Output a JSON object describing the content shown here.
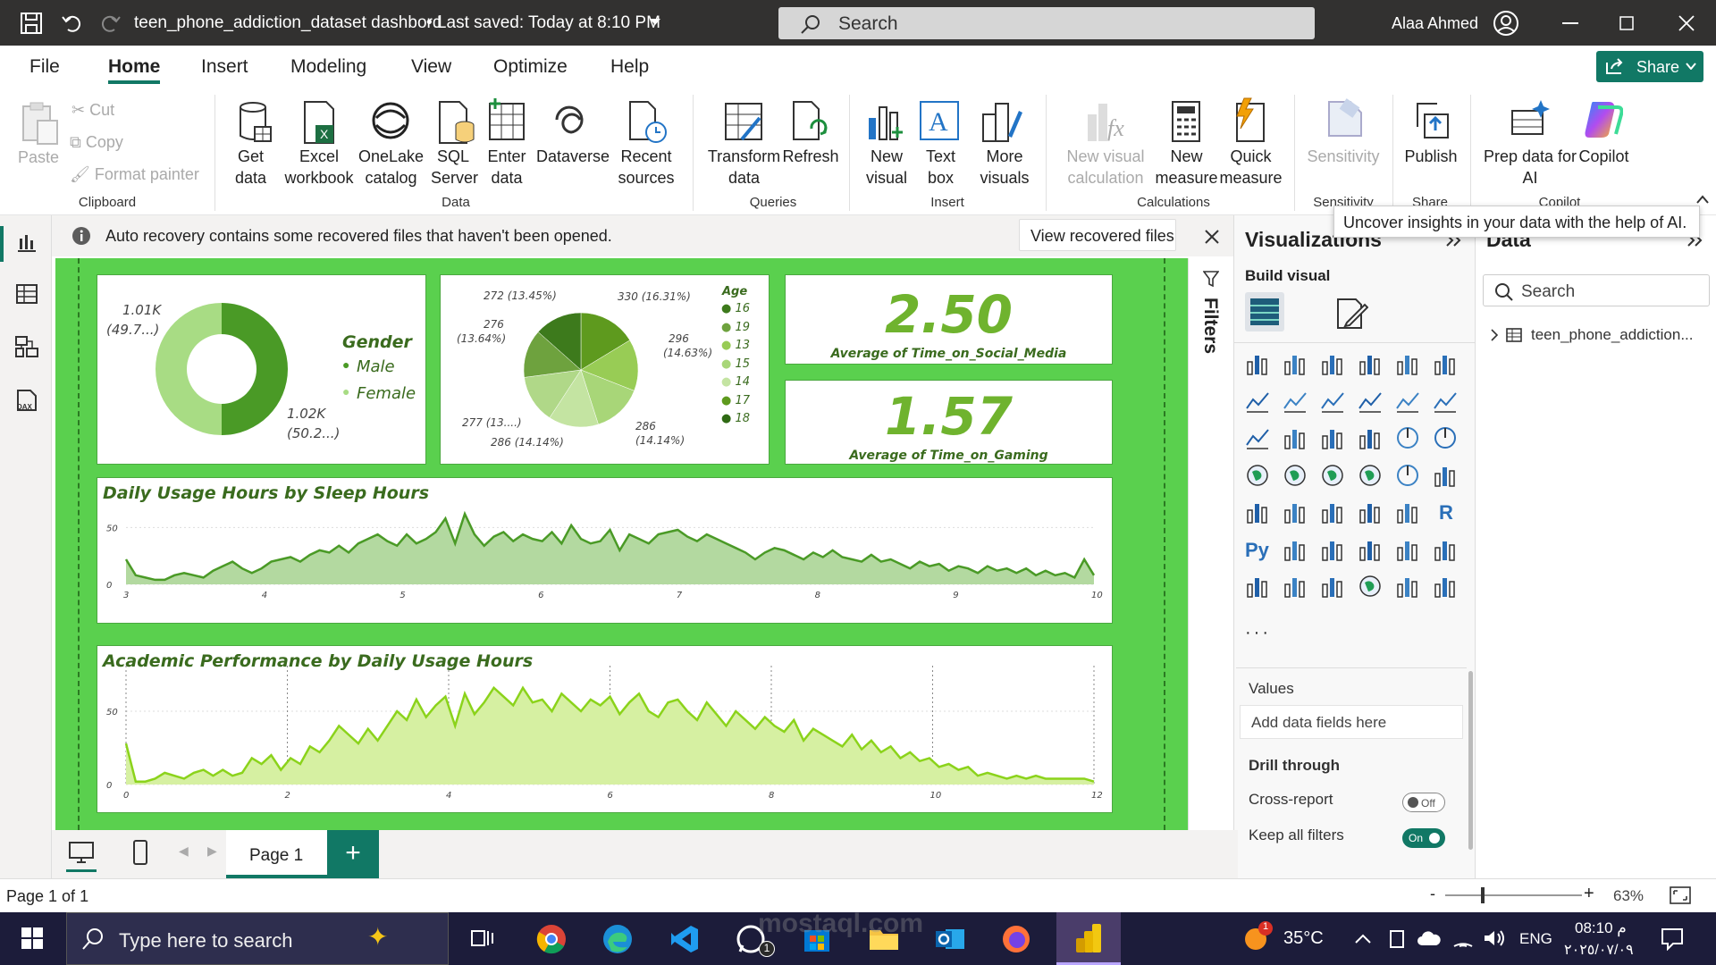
{
  "titlebar": {
    "title": "teen_phone_addiction_dataset dashbord",
    "saved": "• Last saved: Today at 8:10 PM",
    "search": "Search",
    "user": "Alaa Ahmed"
  },
  "tabs": [
    "File",
    "Home",
    "Insert",
    "Modeling",
    "View",
    "Optimize",
    "Help"
  ],
  "share": "Share",
  "ribbon": {
    "clipboard": {
      "paste": "Paste",
      "cut": "Cut",
      "copy": "Copy",
      "format_painter": "Format painter",
      "label": "Clipboard"
    },
    "data": {
      "get_data": "Get data",
      "excel": "Excel workbook",
      "onelake": "OneLake catalog",
      "sql": "SQL Server",
      "enter": "Enter data",
      "dataverse": "Dataverse",
      "recent": "Recent sources",
      "label": "Data"
    },
    "queries": {
      "transform": "Transform data",
      "refresh": "Refresh",
      "label": "Queries"
    },
    "insert": {
      "new_visual": "New visual",
      "text_box": "Text box",
      "more_visuals": "More visuals",
      "label": "Insert"
    },
    "calculations": {
      "new_visual_calc": "New visual calculation",
      "new_measure": "New measure",
      "quick_measure": "Quick measure",
      "label": "Calculations"
    },
    "sensitivity": {
      "label": "Sensitivity",
      "group": "Sensitivity"
    },
    "share": {
      "publish": "Publish",
      "group": "Share"
    },
    "copilot": {
      "prep": "Prep data for AI",
      "copilot": "Copilot",
      "group": "Copilot"
    }
  },
  "tooltip": "Uncover insights in your data with the help of AI.",
  "banner": {
    "text": "Auto recovery contains some recovered files that haven't been opened.",
    "button": "View recovered files"
  },
  "filters_label": "Filters",
  "gender": {
    "title": "Gender",
    "male": "Male",
    "female": "Female",
    "male_label": "1.02K",
    "male_pct": "(50.2...)",
    "female_label": "1.01K",
    "female_pct": "(49.7...)",
    "male_color": "#4a9a26",
    "female_color": "#a8dc84"
  },
  "age": {
    "title": "Age",
    "legend": [
      "16",
      "19",
      "13",
      "15",
      "14",
      "17",
      "18"
    ],
    "labels": {
      "a": "272 (13.45%)",
      "b": "330 (16.31%)",
      "c": "276",
      "c2": "(13.64%)",
      "d": "296",
      "d2": "(14.63%)",
      "e": "277 (13....)",
      "f": "286 (14.14%)",
      "g": "286",
      "g2": "(14.14%)"
    }
  },
  "kpi1": {
    "value": "2.50",
    "label": "Average of Time_on_Social_Media"
  },
  "kpi2": {
    "value": "1.57",
    "label": "Average of Time_on_Gaming"
  },
  "chart_data": [
    {
      "type": "area",
      "title": "Daily Usage Hours by Sleep Hours",
      "x_ticks": [
        "3",
        "4",
        "5",
        "6",
        "7",
        "8",
        "9",
        "10"
      ],
      "y_ticks": [
        "0",
        "50"
      ],
      "ylim": [
        0,
        70
      ],
      "values": [
        22,
        8,
        6,
        4,
        4,
        8,
        10,
        8,
        6,
        12,
        16,
        20,
        14,
        10,
        14,
        20,
        22,
        24,
        20,
        26,
        30,
        28,
        34,
        28,
        36,
        40,
        44,
        38,
        34,
        44,
        36,
        40,
        46,
        58,
        36,
        62,
        44,
        34,
        42,
        46,
        38,
        44,
        40,
        38,
        46,
        36,
        52,
        40,
        36,
        38,
        48,
        30,
        44,
        40,
        36,
        44,
        46,
        48,
        42,
        38,
        44,
        40,
        36,
        32,
        28,
        22,
        28,
        32,
        30,
        26,
        22,
        28,
        24,
        30,
        24,
        22,
        20,
        26,
        20,
        22,
        18,
        14,
        20,
        16,
        18,
        12,
        16,
        14,
        10,
        16,
        12,
        14,
        10,
        14,
        8,
        12,
        8,
        10,
        6,
        22,
        8
      ]
    },
    {
      "type": "area",
      "title": "Academic Performance by Daily Usage Hours",
      "x_ticks": [
        "0",
        "2",
        "4",
        "6",
        "8",
        "10",
        "12"
      ],
      "y_ticks": [
        "0",
        "50"
      ],
      "ylim": [
        0,
        75
      ],
      "values": [
        28,
        2,
        2,
        4,
        8,
        6,
        4,
        8,
        10,
        6,
        10,
        6,
        8,
        18,
        14,
        20,
        10,
        18,
        14,
        26,
        22,
        30,
        40,
        34,
        28,
        38,
        30,
        40,
        50,
        44,
        58,
        46,
        54,
        60,
        40,
        62,
        48,
        56,
        66,
        60,
        54,
        66,
        56,
        58,
        50,
        62,
        56,
        50,
        58,
        54,
        60,
        48,
        56,
        62,
        50,
        46,
        56,
        58,
        50,
        44,
        56,
        48,
        40,
        50,
        44,
        38,
        46,
        40,
        36,
        44,
        30,
        38,
        34,
        30,
        26,
        34,
        24,
        30,
        22,
        26,
        18,
        22,
        16,
        18,
        12,
        14,
        10,
        12,
        6,
        8,
        6,
        4,
        6,
        4,
        6,
        4,
        4,
        4,
        4,
        4,
        2
      ]
    }
  ],
  "viz": {
    "title": "Visualizations",
    "build": "Build visual",
    "values": "Values",
    "add": "Add data fields here",
    "drill": "Drill through",
    "cross": "Cross-report",
    "cross_state": "Off",
    "keep": "Keep all filters",
    "keep_state": "On"
  },
  "data_pane": {
    "title": "Data",
    "search": "Search",
    "table": "teen_phone_addiction..."
  },
  "page": {
    "tab": "Page 1",
    "status": "Page 1 of 1",
    "zoom": "63%"
  },
  "taskbar": {
    "search": "Type here to search",
    "temp": "35°C",
    "lang": "ENG",
    "time": "08:10 م",
    "date": "٢٠٢٥/٠٧/٠٩",
    "notif": "1"
  },
  "watermark": "mostaql.com"
}
